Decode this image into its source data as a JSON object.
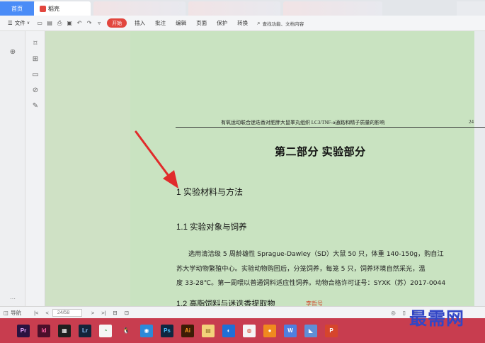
{
  "tabs": [
    {
      "label": "首页",
      "active": false
    },
    {
      "label": "稻壳",
      "active": true
    }
  ],
  "toolbar": {
    "file_menu": "文件",
    "start": "开始",
    "items": [
      "插入",
      "批注",
      "编辑",
      "页面",
      "保护",
      "转换"
    ],
    "search_placeholder": "查找功能、文档内容"
  },
  "document": {
    "running_head": "有氧运动联合迷迭香对肥胖大鼠睾丸组织 LC3/TNF-α通路和精子质量的影响",
    "page_number": "24",
    "part_title": "第二部分  实验部分",
    "heading1": "1  实验材料与方法",
    "heading1_1": "1.1 实验对象与饲养",
    "paragraph_lines": [
      "选用清洁级 5 周龄雄性 Sprague-Dawley（SD）大鼠 50 只，体重 140-150g，购自江",
      "苏大学动物繁殖中心。实验动物购回后，分笼饲养，每笼 5 只，饲养环境自然采光，温",
      "度 33-28℃。第一周喂以普通饲料适应性饲养。动物合格许可证号：SYXK（苏）2017-0044"
    ],
    "heading1_2": "1.2  高脂饲料与迷迭香提取物",
    "comment_author": "李哲号"
  },
  "statusbar": {
    "nav_label": "导航",
    "page_value": "24/58",
    "more": "···"
  },
  "taskbar": {
    "apps": [
      {
        "label": "Pr",
        "color": "#2a1240",
        "fg": "#e9a6ff",
        "icon": "premiere-icon"
      },
      {
        "label": "Id",
        "color": "#4a0f2a",
        "fg": "#ff5ea4",
        "icon": "indesign-icon"
      },
      {
        "label": "▦",
        "color": "#1f1f1f",
        "fg": "#ffffff",
        "icon": "film-icon"
      },
      {
        "label": "Lr",
        "color": "#13243a",
        "fg": "#8fc6ff",
        "icon": "lightroom-icon"
      },
      {
        "label": "◔",
        "color": "#f5f5f5",
        "fg": "#2d8c3a",
        "icon": "pinwheel-icon"
      },
      {
        "label": "🐧",
        "color": "#c83d4f",
        "fg": "#ffffff",
        "icon": "qq-icon"
      },
      {
        "label": "◉",
        "color": "#2c8ad8",
        "fg": "#ffffff",
        "icon": "face-app-icon"
      },
      {
        "label": "Ps",
        "color": "#0f2740",
        "fg": "#4cc0ff",
        "icon": "photoshop-icon"
      },
      {
        "label": "Ai",
        "color": "#3d1c05",
        "fg": "#ff9a1f",
        "icon": "illustrator-icon"
      },
      {
        "label": "▤",
        "color": "#f3d27a",
        "fg": "#8a6a22",
        "icon": "folder-icon"
      },
      {
        "label": "◐",
        "color": "#1f6fd6",
        "fg": "#ffffff",
        "icon": "browser-icon"
      },
      {
        "label": "◍",
        "color": "#f4f4f4",
        "fg": "#d6452c",
        "icon": "chrome-icon"
      },
      {
        "label": "●",
        "color": "#f08a1e",
        "fg": "#ffffff",
        "icon": "firefox-icon"
      },
      {
        "label": "W",
        "color": "#4f7fe0",
        "fg": "#ffffff",
        "icon": "wps-icon"
      },
      {
        "label": "◣",
        "color": "#5f8fd6",
        "fg": "#ffffff",
        "icon": "app-icon"
      },
      {
        "label": "P",
        "color": "#d6452c",
        "fg": "#ffffff",
        "icon": "wps-presentation-icon"
      }
    ]
  },
  "watermark": "最需网",
  "colors": {
    "page_background": "#c9e3c1",
    "start_button": "#e2463e",
    "taskbar": "#c83d4f",
    "annotation_arrow": "#e02b2b"
  }
}
